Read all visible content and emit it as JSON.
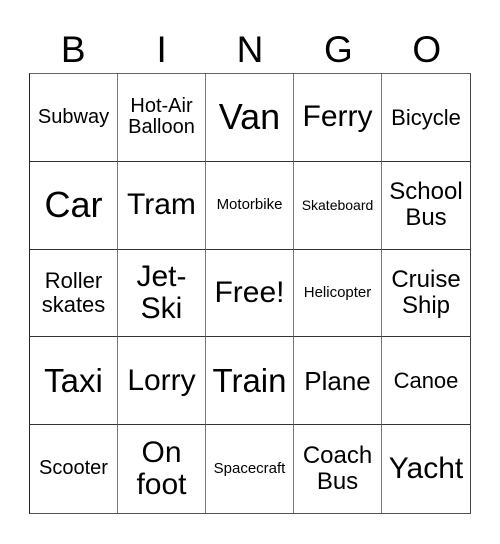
{
  "header": [
    "B",
    "I",
    "N",
    "G",
    "O"
  ],
  "rows": [
    [
      "Subway",
      "Hot-Air Balloon",
      "Van",
      "Ferry",
      "Bicycle"
    ],
    [
      "Car",
      "Tram",
      "Motorbike",
      "Skateboard",
      "School Bus"
    ],
    [
      "Roller skates",
      "Jet-Ski",
      "Free!",
      "Helicopter",
      "Cruise Ship"
    ],
    [
      "Taxi",
      "Lorry",
      "Train",
      "Plane",
      "Canoe"
    ],
    [
      "Scooter",
      "On foot",
      "Spacecraft",
      "Coach Bus",
      "Yacht"
    ]
  ]
}
